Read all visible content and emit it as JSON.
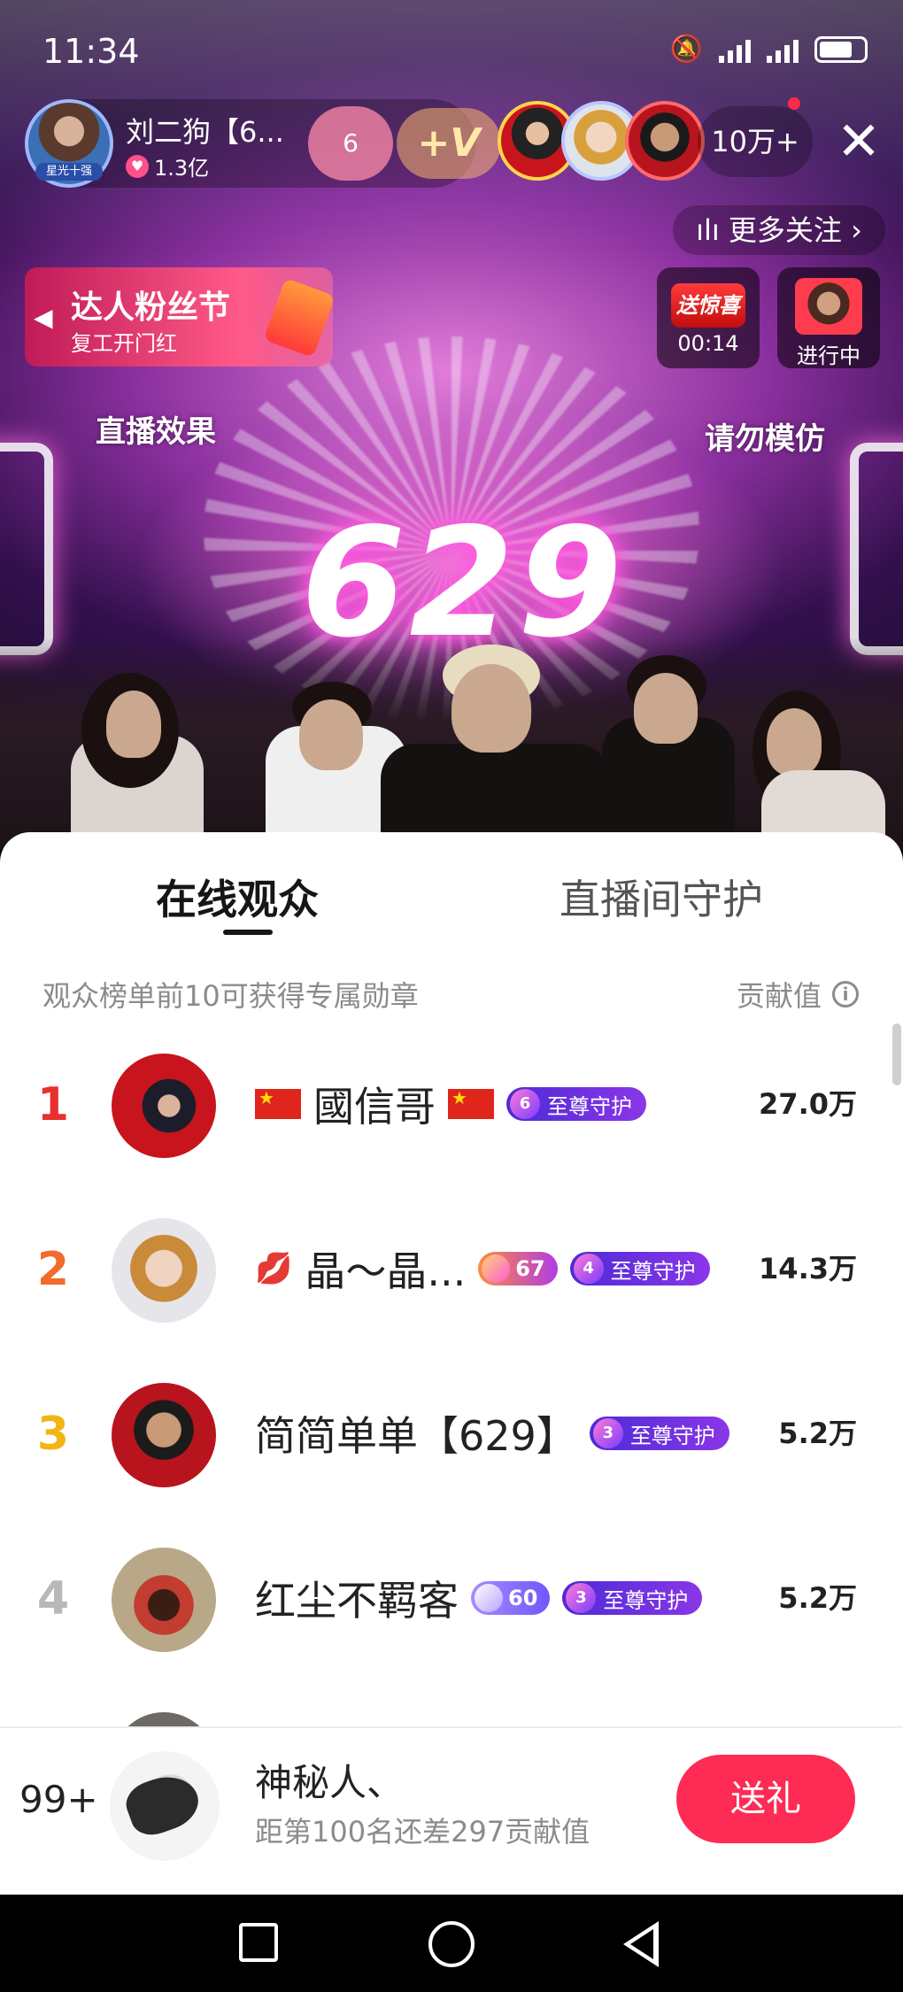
{
  "status_bar": {
    "time": "11:34"
  },
  "host": {
    "name": "刘二狗【6...",
    "likes": "1.3亿",
    "avatar_tag": "星光十强",
    "fan_level": "6",
    "plus_label": "+V"
  },
  "viewer_count": "10万+",
  "more_follow": "更多关注",
  "fan_festival": {
    "title": "达人粉丝节",
    "subtitle": "复工开门红"
  },
  "surprise": {
    "label": "送惊喜",
    "countdown": "00:14"
  },
  "ongoing": {
    "label": "进行中"
  },
  "stage_text": {
    "big": "629",
    "left_mark": "直播效果",
    "right_mark": "请勿模仿"
  },
  "tabs": [
    {
      "label": "在线观众"
    },
    {
      "label": "直播间守护"
    }
  ],
  "subhead": "观众榜单前10可获得专属勋章",
  "contrib_header": "贡献值",
  "ranking": [
    {
      "rank": "1",
      "name": "國信哥",
      "guard_level": "6",
      "guard_label": "至尊守护",
      "value": "27.0万",
      "rank_color": "#e8312f"
    },
    {
      "rank": "2",
      "name": "晶～晶...",
      "fan_level": "67",
      "guard_level": "4",
      "guard_label": "至尊守护",
      "value": "14.3万",
      "rank_color": "#f26b2a"
    },
    {
      "rank": "3",
      "name": "简简单单【629】",
      "guard_level": "3",
      "guard_label": "至尊守护",
      "value": "5.2万",
      "rank_color": "#f3b515"
    },
    {
      "rank": "4",
      "name": "红尘不羁客",
      "fan_level": "60",
      "guard_level": "3",
      "guard_label": "至尊守护",
      "value": "5.2万",
      "rank_color": "#b8b8b8"
    }
  ],
  "self": {
    "rank": "99+",
    "name": "神秘人、",
    "diff_text": "距第100名还差297贡献值",
    "gift_button": "送礼"
  },
  "colors": {
    "accent": "#fe2c55",
    "guard_badge": "#5a2fe0"
  }
}
